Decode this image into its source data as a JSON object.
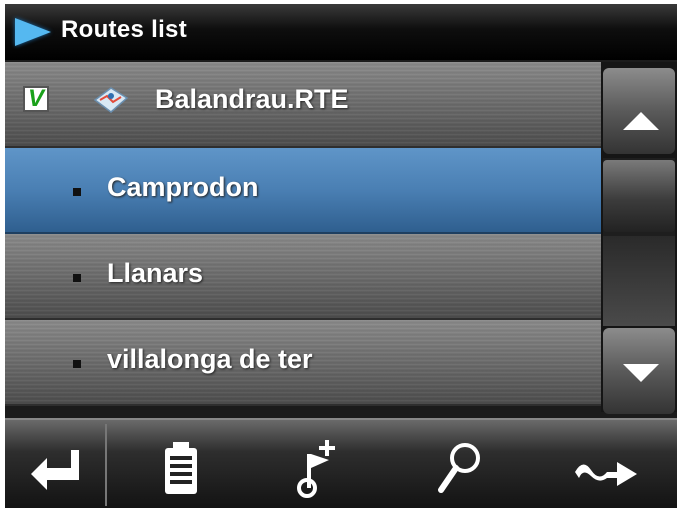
{
  "header": {
    "title": "Routes list",
    "icon": "play-arrow-icon",
    "accent": "#55b8f0"
  },
  "routes": {
    "file": {
      "name": "Balandrau.RTE",
      "checked": true,
      "check_mark": "V",
      "icon": "route-map-icon"
    },
    "items": [
      {
        "label": "Camprodon",
        "selected": true
      },
      {
        "label": "Llanars",
        "selected": false
      },
      {
        "label": "villalonga de ter",
        "selected": false
      }
    ]
  },
  "scrollbar": {
    "up": "scroll-up-arrow-icon",
    "down": "scroll-down-arrow-icon"
  },
  "toolbar": {
    "buttons": [
      {
        "name": "back",
        "icon": "return-arrow-icon"
      },
      {
        "name": "list",
        "icon": "clipboard-icon"
      },
      {
        "name": "add-waypoint",
        "icon": "flag-plus-icon"
      },
      {
        "name": "search",
        "icon": "magnifier-icon"
      },
      {
        "name": "navigate",
        "icon": "route-arrow-icon"
      }
    ]
  },
  "colors": {
    "selection": "#4a7fb3",
    "background": "#1b1b1b"
  }
}
